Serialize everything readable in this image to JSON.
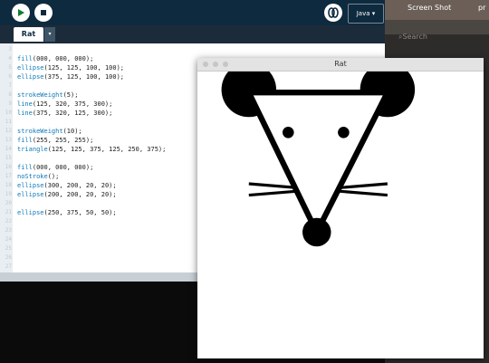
{
  "toolbar": {
    "run_icon": "play-icon",
    "stop_icon": "stop-icon",
    "debug_icon": "debugger-icon",
    "mode": "Java ▾"
  },
  "tab": {
    "label": "Rat",
    "menu": "▾"
  },
  "editor": {
    "line_numbers": [
      "3",
      "4",
      "5",
      "6",
      "7",
      "8",
      "9",
      "10",
      "11",
      "12",
      "13",
      "14",
      "15",
      "16",
      "17",
      "18",
      "19",
      "20",
      "21",
      "22",
      "23",
      "24",
      "25",
      "26",
      "27"
    ],
    "lines": [
      {
        "fn": "",
        "args": ""
      },
      {
        "fn": "fill",
        "args": "(000, 000, 000);"
      },
      {
        "fn": "ellipse",
        "args": "(125, 125, 100, 100);"
      },
      {
        "fn": "ellipse",
        "args": "(375, 125, 100, 100);"
      },
      {
        "fn": "",
        "args": ""
      },
      {
        "fn": "strokeWeight",
        "args": "(5);"
      },
      {
        "fn": "line",
        "args": "(125, 320, 375, 300);"
      },
      {
        "fn": "line",
        "args": "(375, 320, 125, 300);"
      },
      {
        "fn": "",
        "args": ""
      },
      {
        "fn": "strokeWeight",
        "args": "(10);"
      },
      {
        "fn": "fill",
        "args": "(255, 255, 255);"
      },
      {
        "fn": "triangle",
        "args": "(125, 125, 375, 125, 250, 375);"
      },
      {
        "fn": "",
        "args": ""
      },
      {
        "fn": "fill",
        "args": "(000, 000, 000);"
      },
      {
        "fn": "noStroke",
        "args": "();"
      },
      {
        "fn": "ellipse",
        "args": "(300, 200, 20, 20);"
      },
      {
        "fn": "ellipse",
        "args": "(200, 200, 20, 20);"
      },
      {
        "fn": "",
        "args": ""
      },
      {
        "fn": "ellipse",
        "args": "(250, 375, 50, 50);"
      }
    ]
  },
  "desktop": {
    "screenshot_label": "Screen Shot",
    "pr_label": "pr",
    "search_placeholder": "Search"
  },
  "sketch_window": {
    "title": "Rat"
  }
}
